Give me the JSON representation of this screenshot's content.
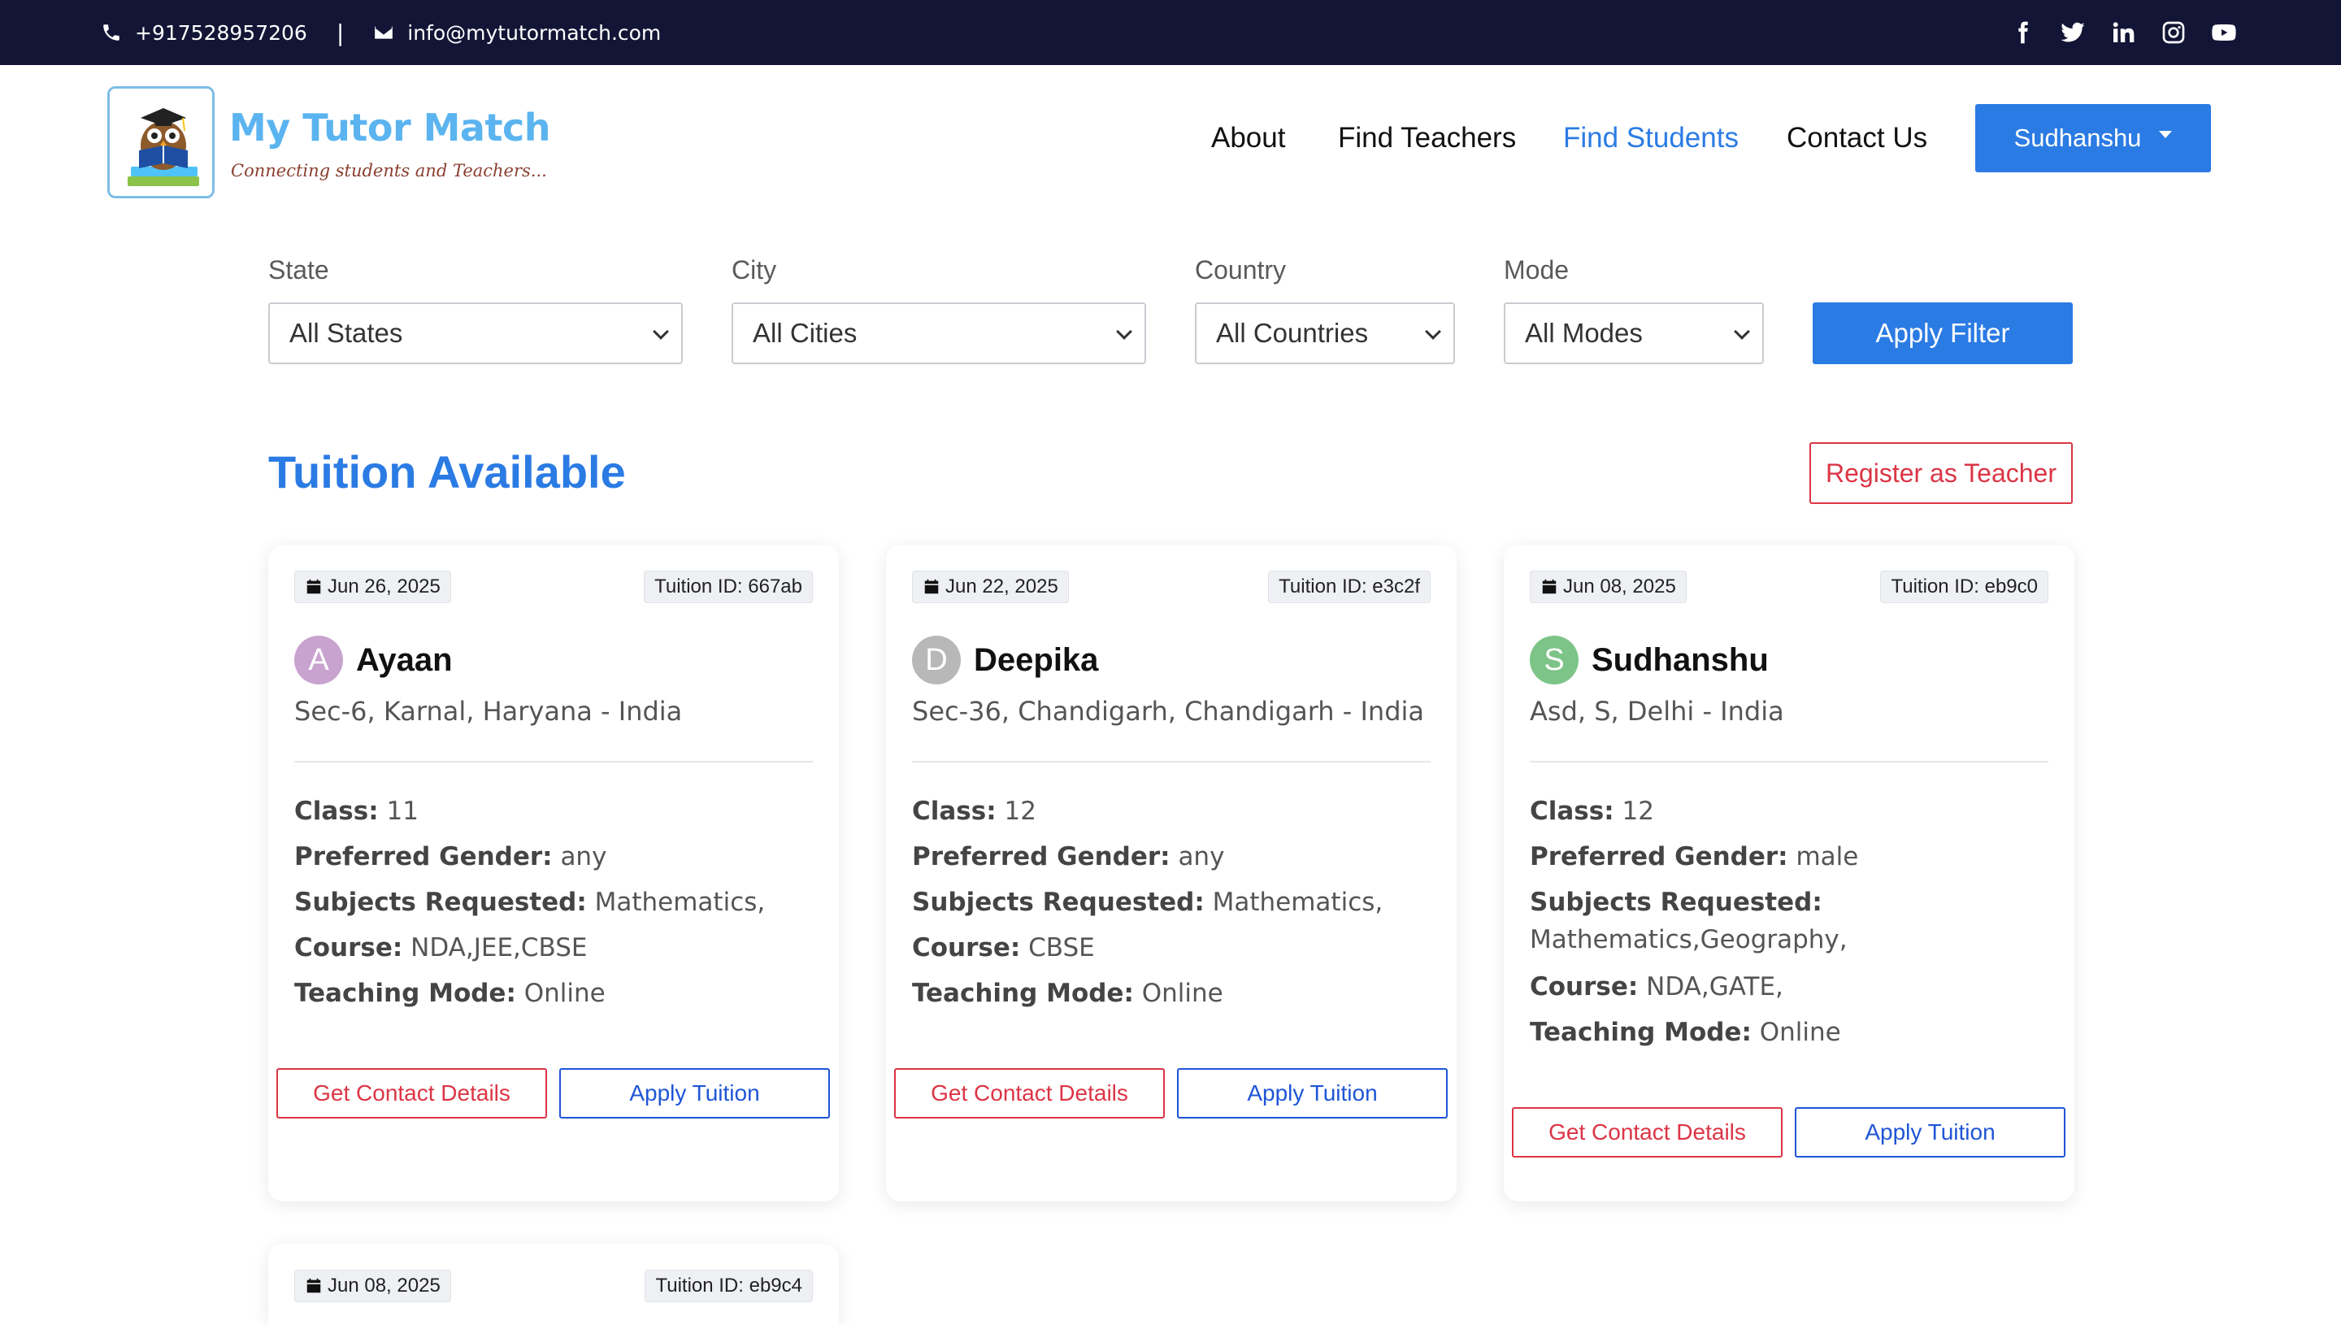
{
  "topbar": {
    "phone": "+917528957206",
    "separator": "|",
    "email": "info@mytutormatch.com",
    "social": [
      "facebook-icon",
      "twitter-icon",
      "linkedin-icon",
      "instagram-icon",
      "youtube-icon"
    ]
  },
  "header": {
    "brand": "My Tutor Match",
    "tagline": "Connecting students and Teachers...",
    "nav": [
      {
        "label": "About"
      },
      {
        "label": "Find Teachers"
      },
      {
        "label": "Find Students",
        "active": true
      },
      {
        "label": "Contact Us"
      }
    ],
    "user": "Sudhanshu"
  },
  "filters": {
    "state": {
      "label": "State",
      "value": "All States"
    },
    "city": {
      "label": "City",
      "value": "All Cities"
    },
    "country": {
      "label": "Country",
      "value": "All Countries"
    },
    "mode": {
      "label": "Mode",
      "value": "All Modes"
    },
    "apply": "Apply Filter"
  },
  "section": {
    "title": "Tuition Available",
    "register": "Register as Teacher"
  },
  "labels": {
    "class": "Class:",
    "gender": "Preferred Gender:",
    "subjects": "Subjects Requested:",
    "course": "Course:",
    "mode": "Teaching Mode:",
    "contact_btn": "Get Contact Details",
    "apply_btn": "Apply Tuition"
  },
  "cards": [
    {
      "date": "Jun 26, 2025",
      "tid": "Tuition ID: 667ab",
      "initial": "A",
      "avatar_color": "#c9a3d0",
      "name": "Ayaan",
      "location": "Sec-6, Karnal, Haryana - India",
      "class": "11",
      "gender": "any",
      "subjects": "Mathematics,",
      "course": "NDA,JEE,CBSE",
      "mode": "Online"
    },
    {
      "date": "Jun 22, 2025",
      "tid": "Tuition ID: e3c2f",
      "initial": "D",
      "avatar_color": "#b8b8b8",
      "name": "Deepika",
      "location": "Sec-36, Chandigarh, Chandigarh - India",
      "class": "12",
      "gender": "any",
      "subjects": "Mathematics,",
      "course": "CBSE",
      "mode": "Online"
    },
    {
      "date": "Jun 08, 2025",
      "tid": "Tuition ID: eb9c0",
      "initial": "S",
      "avatar_color": "#7cc487",
      "name": "Sudhanshu",
      "location": "Asd, S, Delhi - India",
      "class": "12",
      "gender": "male",
      "subjects": "Mathematics,Geography,",
      "course": "NDA,GATE,",
      "mode": "Online"
    },
    {
      "date": "Jun 08, 2025",
      "tid": "Tuition ID: eb9c4"
    }
  ]
}
